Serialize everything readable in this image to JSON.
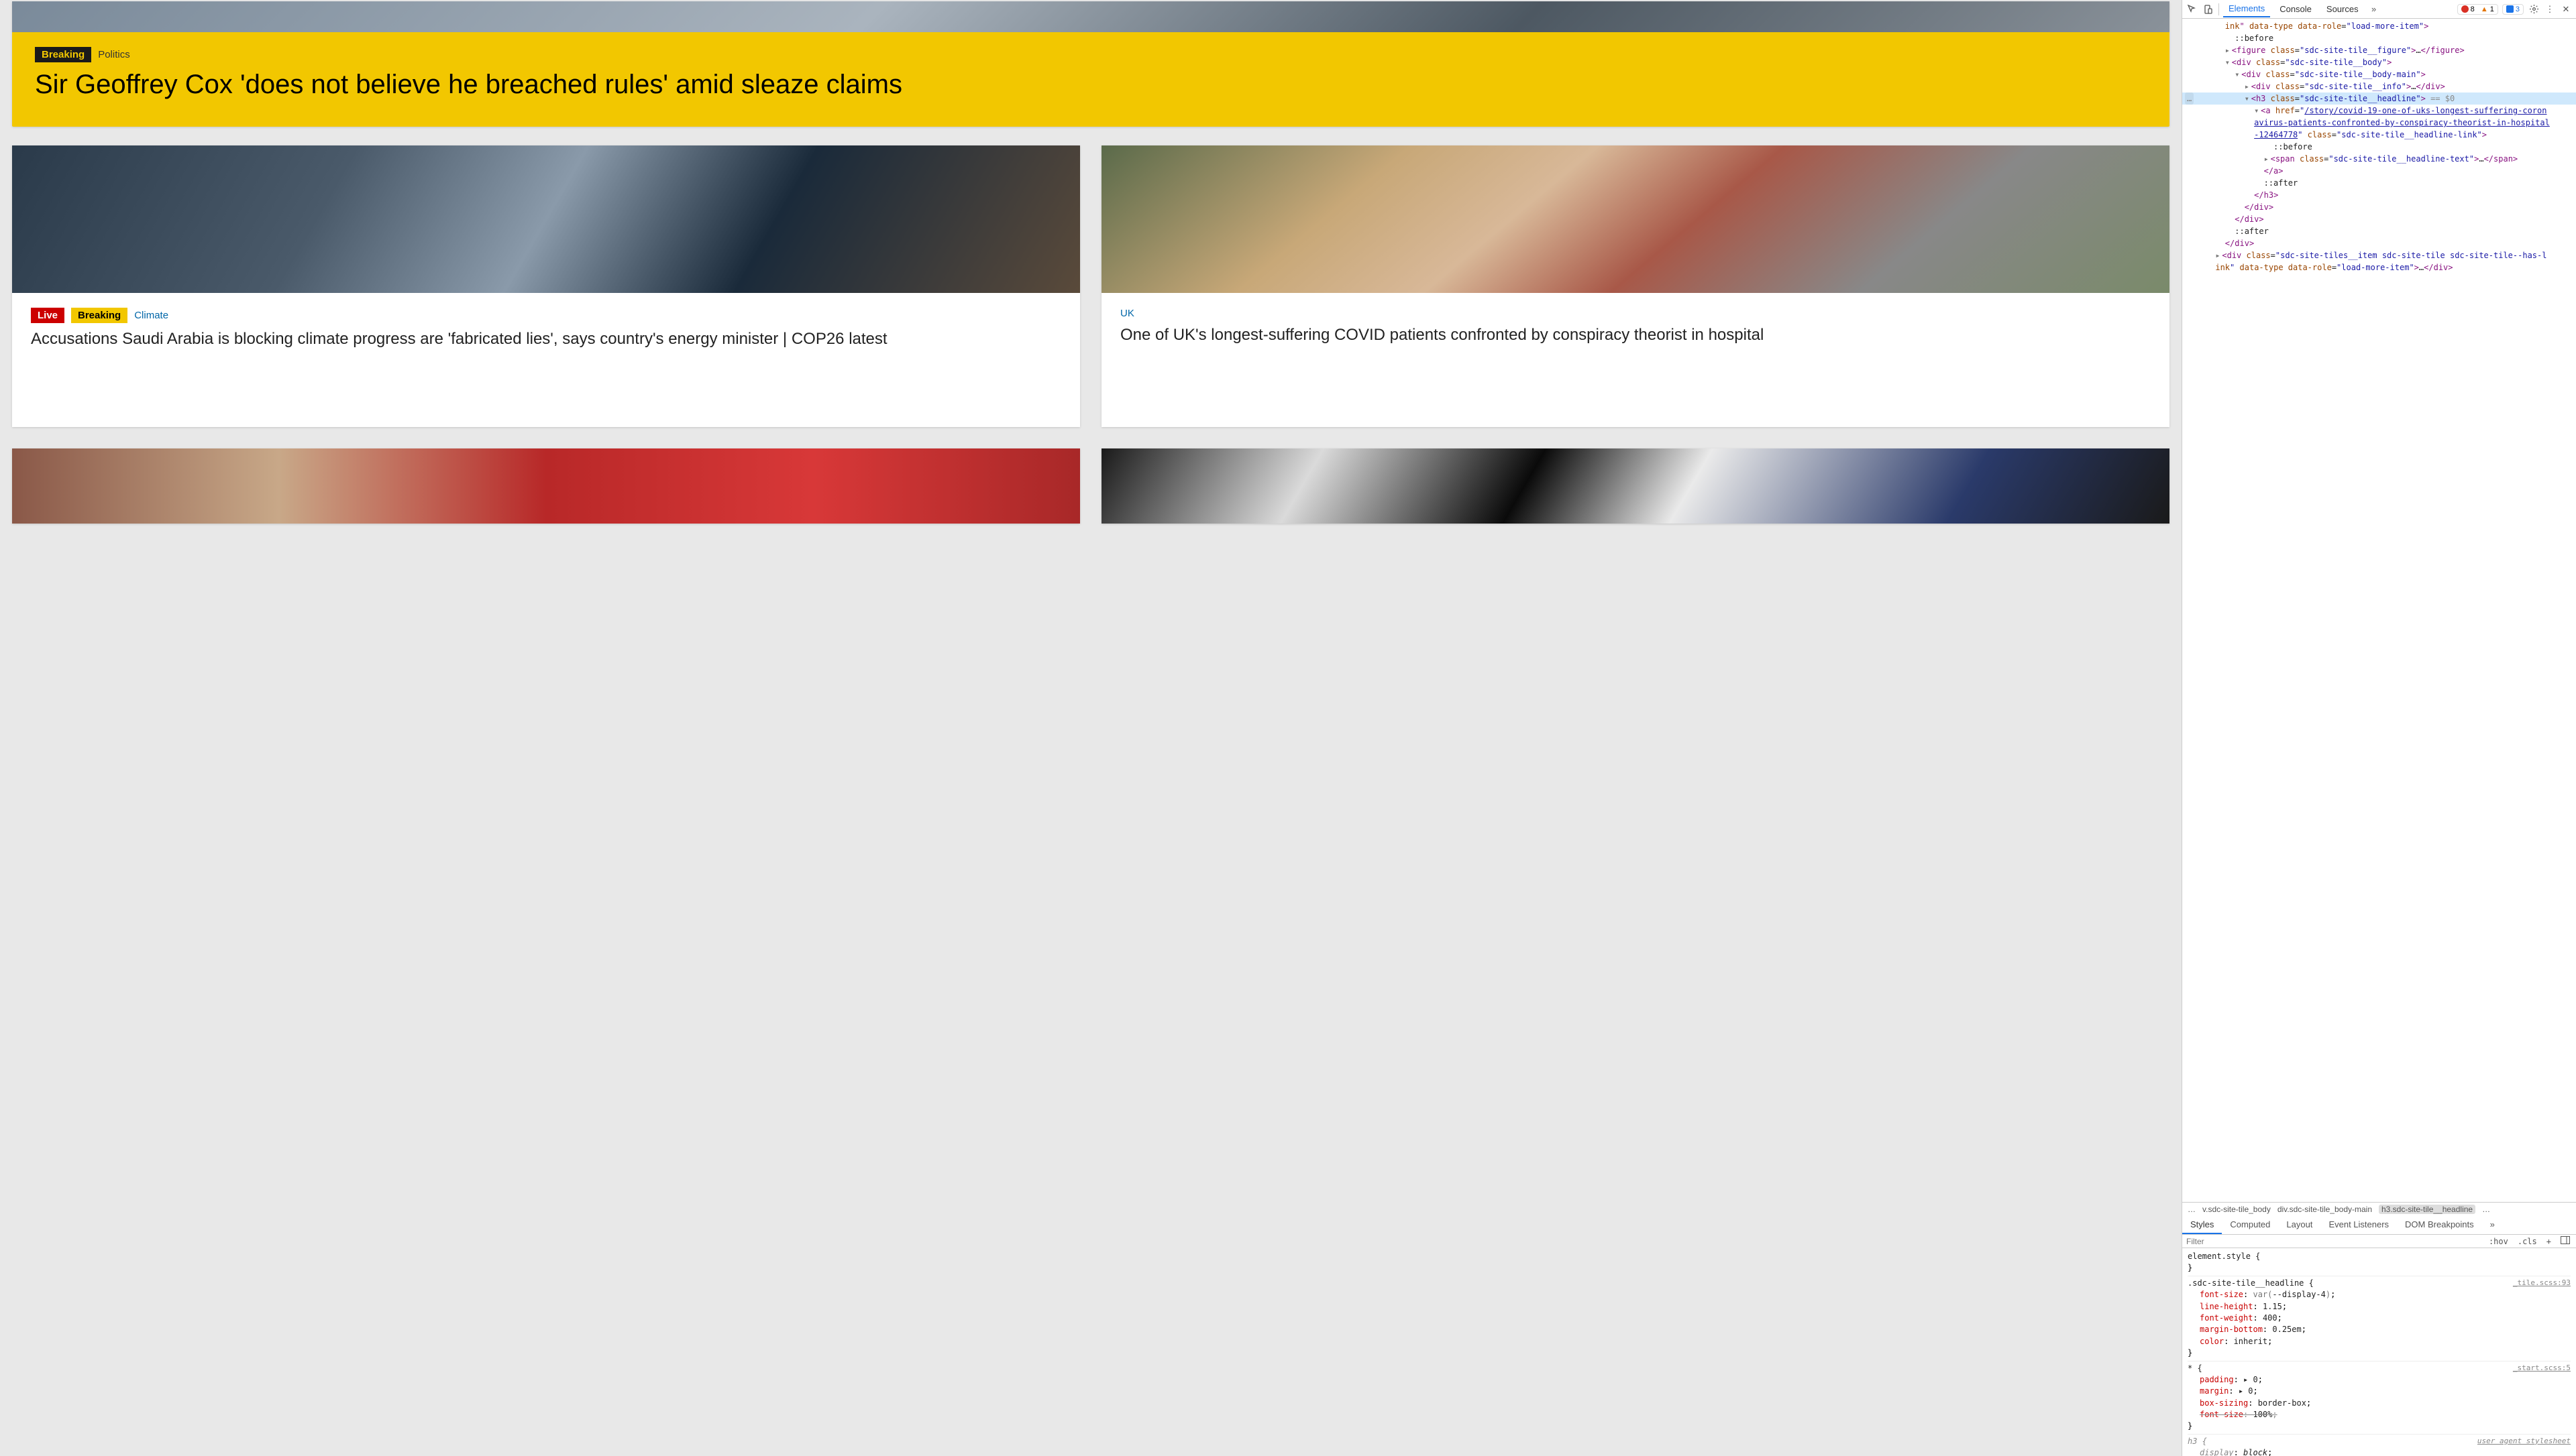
{
  "hero": {
    "badge": "Breaking",
    "category": "Politics",
    "headline": "Sir Geoffrey Cox 'does not believe he breached rules' amid sleaze claims"
  },
  "tiles": [
    {
      "live": "Live",
      "badge": "Breaking",
      "category": "Climate",
      "headline": "Accusations Saudi Arabia is blocking climate progress are 'fabricated lies', says country's energy minister | COP26 latest"
    },
    {
      "category": "UK",
      "headline": "One of UK's longest-suffering COVID patients confronted by conspiracy theorist in hospital"
    }
  ],
  "devtools": {
    "tabs": {
      "elements": "Elements",
      "console": "Console",
      "sources": "Sources"
    },
    "errors": "8",
    "warnings": "1",
    "issues": "3",
    "dom": {
      "dataRole": "data-role",
      "loadMore": "load-more-item",
      "dataType": "data-type",
      "before": "::before",
      "after": "::after",
      "figure": "figure",
      "figureClass": "sdc-site-tile__figure",
      "div": "div",
      "bodyClass": "sdc-site-tile__body",
      "bodyMainClass": "sdc-site-tile__body-main",
      "infoClass": "sdc-site-tile__info",
      "h3": "h3",
      "headlineClass": "sdc-site-tile__headline",
      "eq0": " == $0",
      "a": "a",
      "href": "href",
      "hrefVal1": "/story/covid-19-one-of-uks-longest-suffering-coron",
      "hrefVal2": "avirus-patients-confronted-by-conspiracy-theorist-in-hospital",
      "hrefVal3": "-12464778",
      "linkClass": "sdc-site-tile__headline-link",
      "span": "span",
      "textClass": "sdc-site-tile__headline-text",
      "itemClass": "sdc-site-tiles__item sdc-site-tile sdc-site-tile--has-l",
      "ink": "ink",
      "classAttr": "class"
    },
    "crumbs": {
      "dots": "…",
      "c1": "v.sdc-site-tile_body",
      "c2": "div.sdc-site-tile_body-main",
      "c3": "h3.sdc-site-tile__headline",
      "c4": "…"
    },
    "stylesTabs": {
      "styles": "Styles",
      "computed": "Computed",
      "layout": "Layout",
      "events": "Event Listeners",
      "dom": "DOM Breakpoints"
    },
    "filter": {
      "placeholder": "Filter",
      "hov": ":hov",
      "cls": ".cls",
      "plus": "+"
    },
    "rules": {
      "elementStyle": "element.style {",
      "close": "}",
      "headlineSel": ".sdc-site-tile__headline {",
      "headlineSrc": "_tile.scss:93",
      "fontSize": "font-size",
      "fontSizeVal": "var(--display-4)",
      "lineHeight": "line-height",
      "lineHeightVal": "1.15",
      "fontWeight": "font-weight",
      "fontWeightVal": "400",
      "marginBottom": "margin-bottom",
      "marginBottomVal": "0.25em",
      "color": "color",
      "colorVal": "inherit",
      "starSel": "* {",
      "starSrc": "_start.scss:5",
      "padding": "padding",
      "paddingVal": "▸ 0",
      "margin": "margin",
      "marginVal": "▸ 0",
      "boxSizing": "box-sizing",
      "boxSizingVal": "border-box",
      "fontSizeStar": "font-size",
      "fontSizeStarVal": "100%",
      "h3Sel": "h3 {",
      "uaLabel": "user agent stylesheet",
      "display": "display",
      "displayVal": "block"
    }
  }
}
